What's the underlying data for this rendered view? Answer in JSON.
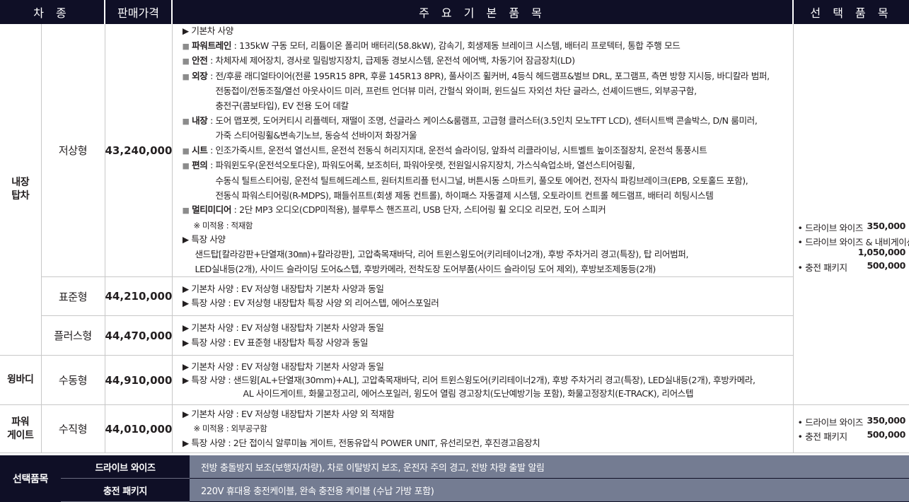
{
  "headers": {
    "model": "차 종",
    "price": "판매가격",
    "features": "주 요 기 본 품 목",
    "options": "선 택 품 목"
  },
  "groups": {
    "g1": "내장\n탑차",
    "g2": "윙바디",
    "g3": "파워\n게이트"
  },
  "rows": [
    {
      "trim": "저상형",
      "price": "43,240,000"
    },
    {
      "trim": "표준형",
      "price": "44,210,000"
    },
    {
      "trim": "플러스형",
      "price": "44,470,000"
    },
    {
      "trim": "수동형",
      "price": "44,910,000"
    },
    {
      "trim": "수직형",
      "price": "44,010,000"
    }
  ],
  "row1": {
    "basic_title": "▶ 기본차 사양",
    "powertrain_label": "파워트레인",
    "powertrain": " : 135kW 구동 모터, 리튬이온 폴리머 배터리(58.8kW), 감속기, 회생제동 브레이크 시스템, 배터리 프로텍터, 통합 주행 모드",
    "safety_label": "안전",
    "safety": " : 차체자세 제어장치, 경사로 밀림방지장치, 급제동 경보시스템, 운전석 에어백, 차동기어 잠금장치(LD)",
    "ext_label": "외장",
    "ext1": " : 전/후륜 래디얼타이어(전륜 195R15 8PR, 후륜 145R13 8PR), 풀사이즈 휠커버, 4등식 헤드램프&벌브 DRL, 포그램프, 측면 방향 지시등, 바디칼라 범퍼,",
    "ext2": "전동접이/전동조절/열선 아웃사이드 미러, 프런트 언더뷰 미러, 간헐식 와이퍼, 윈드실드 자외선 차단 글라스, 선셰이드밴드, 외부공구함,",
    "ext3": "충전구(콤보타입), EV 전용 도어 데칼",
    "int_label": "내장",
    "int1": " : 도어 맵포켓, 도어커티시 리플렉터, 재떨이 조명, 선글라스 케이스&룸램프, 고급형 클러스터(3.5인치 모노TFT LCD), 센터시트백 콘솔박스, D/N 룸미러,",
    "int2": "가죽 스티어링휠&변속기노브, 동승석 선바이저 화장거울",
    "seat_label": "시트",
    "seat": " : 인조가죽시트, 운전석 열선시트, 운전석 전동식 허리지지대, 운전석 슬라이딩, 앞좌석 리클라이닝, 시트벨트 높이조절장치, 운전석 통풍시트",
    "conv_label": "편의",
    "conv1": " : 파워윈도우(운전석오토다운), 파워도어록, 보조히터, 파워아웃렛, 전원일시유지장치, 가스식쇽업소바, 열선스티어링휠,",
    "conv2": "수동식 틸트스티어링, 운전석 틸트헤드레스트, 원터치트리플 턴시그널, 버튼시동 스마트키, 풀오토 에어컨, 전자식 파킹브레이크(EPB, 오토홀드 포함),",
    "conv3": "전동식 파워스티어링(R-MDPS), 패들쉬프트(회생 제동 컨트롤), 하이패스 자동결제 시스템, 오토라이트 컨트롤 헤드램프, 배터리 히팅시스템",
    "mm_label": "멀티미디어",
    "mm": " : 2단 MP3 오디오(CDP미적용), 블루투스 핸즈프리, USB 단자, 스티어링 휠 오디오 리모컨, 도어 스피커",
    "note": "※ 미적용 : 적재함",
    "special_title": "▶ 특장 사양",
    "special1": "샌드탑[칼라강판+단열재(30㎜)+칼라강판], 고압축목재바닥, 리어 트윈스윙도어(키리테이너2개), 후방 주차거리 경고(특장), 탑 리어범퍼,",
    "special2": "LED실내등(2개), 사이드 슬라이딩 도어&스텝, 후방카메라, 전착도장 도어부품(사이드 슬라이딩 도어 제외), 후방보조제동등(2개)"
  },
  "row2": {
    "basic": "▶ 기본차 사양 : EV 저상형 내장탑차 기본차 사양과 동일",
    "special": "▶ 특장 사양     : EV 저상형 내장탑차 특장 사양 외 리어스텝, 에어스포일러"
  },
  "row3": {
    "basic": "▶ 기본차 사양 : EV 저상형 내장탑차 기본차 사양과 동일",
    "special": "▶ 특장 사양     : EV 표준형 내장탑차 특장 사양과 동일"
  },
  "row4": {
    "basic": "▶ 기본차 사양 : EV 저상형 내장탑차 기본차 사양과 동일",
    "special1": "▶ 특장 사양     : 샌드윙[AL+단열재(30mm)+AL], 고압축목재바닥, 리어 트윈스윙도어(키리테이너2개), 후방 주차거리 경고(특장), LED실내등(2개), 후방카메라,",
    "special2": "AL 사이드게이트, 화물고정고리, 에어스포일러, 윙도어 열림 경고장치(도난예방기능 포함), 화물고정장치(E-TRACK), 리어스텝"
  },
  "row5": {
    "basic": "▶ 기본차 사양 : EV 저상형 내장탑차 기본차 사양 외 적재함",
    "note": "※ 미적용 : 외부공구함",
    "special": "▶ 특장 사양     : 2단 접이식 알루미늄 게이트, 전동유압식 POWER UNIT, 유선리모컨, 후진경고음장치"
  },
  "options_a": {
    "opt1_name": "• 드라이브 와이즈",
    "opt1_price": "350,000",
    "opt2_name": "• 드라이브 와이즈 & 내비게이션",
    "opt2_price": "1,050,000",
    "opt3_name": "• 충전 패키지",
    "opt3_price": "500,000"
  },
  "options_b": {
    "opt1_name": "• 드라이브 와이즈",
    "opt1_price": "350,000",
    "opt2_name": "• 충전 패키지",
    "opt2_price": "500,000"
  },
  "bottom": {
    "label": "선택품목",
    "item1_key": "드라이브 와이즈",
    "item1_value": "전방 충돌방지 보조(보행자/차량), 차로 이탈방지 보조, 운전자 주의 경고, 전방 차량 출발 알림",
    "item2_key": "충전 패키지",
    "item2_value": "220V 휴대용 충전케이블, 완속 충전용 케이블 (수납 가방 포함)"
  },
  "colors": {
    "header_bg": "#0f0f26",
    "bottom_value_bg": "#747c92",
    "rule": "#c8c8c8"
  }
}
